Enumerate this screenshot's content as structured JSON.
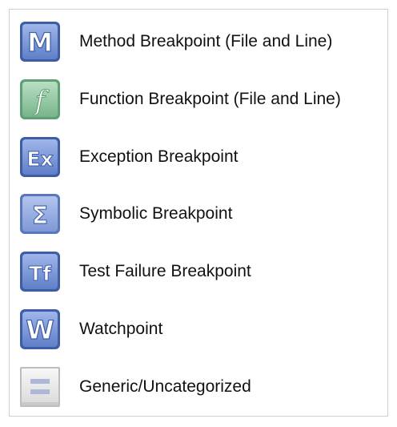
{
  "legend": {
    "items": [
      {
        "icon": "method-breakpoint-icon",
        "glyph": "M",
        "label": "Method Breakpoint (File and Line)"
      },
      {
        "icon": "function-breakpoint-icon",
        "glyph": "f",
        "label": "Function Breakpoint (File and Line)"
      },
      {
        "icon": "exception-breakpoint-icon",
        "glyph": "Ex",
        "label": "Exception Breakpoint"
      },
      {
        "icon": "symbolic-breakpoint-icon",
        "glyph": "Σ",
        "label": "Symbolic Breakpoint"
      },
      {
        "icon": "test-failure-breakpoint-icon",
        "glyph": "Tf",
        "label": "Test Failure Breakpoint"
      },
      {
        "icon": "watchpoint-icon",
        "glyph": "W",
        "label": "Watchpoint"
      },
      {
        "icon": "generic-breakpoint-icon",
        "glyph": "",
        "label": "Generic/Uncategorized"
      }
    ]
  },
  "colors": {
    "blue_fill": "#6f8fd1",
    "blue_dark": "#3f5da6",
    "blue_light_fill": "#8da6dc",
    "green_fill": "#86c29a",
    "green_dark": "#5e9f73",
    "gray_fill": "#ececec",
    "gray_border": "#bdbdbd",
    "gray_bar": "#aeb8d6"
  }
}
